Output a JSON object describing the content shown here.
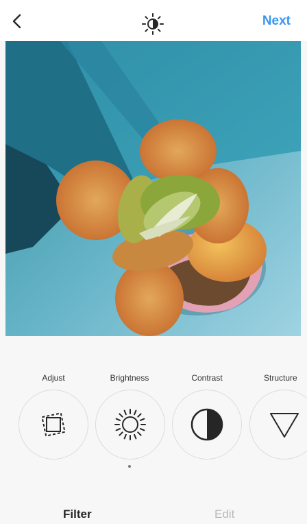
{
  "header": {
    "back_icon": "chevron-left-icon",
    "center_icon": "lux-sun-icon",
    "next_label": "Next",
    "accent_color": "#3897f0"
  },
  "photo": {
    "subject": "succulent-photo"
  },
  "tools": [
    {
      "label": "Adjust",
      "icon": "adjust-frame-icon",
      "selected": false
    },
    {
      "label": "Brightness",
      "icon": "brightness-sun-icon",
      "selected": true
    },
    {
      "label": "Contrast",
      "icon": "contrast-half-circle-icon",
      "selected": false
    },
    {
      "label": "Structure",
      "icon": "structure-triangle-icon",
      "selected": false
    }
  ],
  "bottom_tabs": {
    "filter_label": "Filter",
    "edit_label": "Edit",
    "active": "Filter"
  }
}
